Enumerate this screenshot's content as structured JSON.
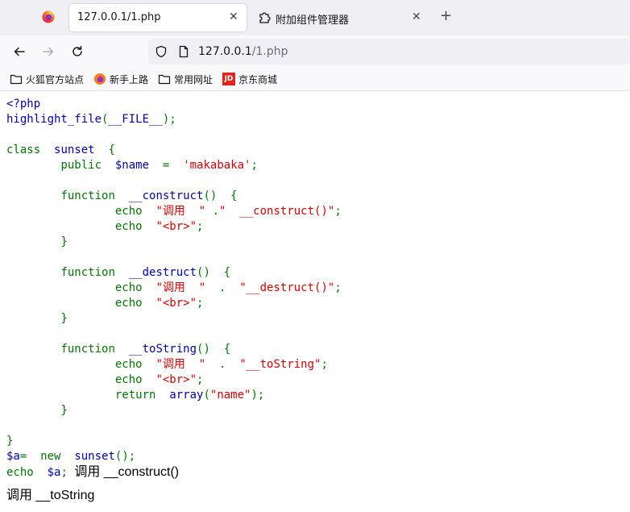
{
  "browser": {
    "tabs": [
      {
        "title": "127.0.0.1/1.php",
        "active": true
      },
      {
        "title": "附加组件管理器",
        "active": false
      }
    ],
    "new_tab_glyph": "+",
    "close_glyph": "✕",
    "url_host": "127.0.0.1",
    "url_path": "/1.php",
    "bookmarks": [
      "火狐官方站点",
      "新手上路",
      "常用网址",
      "京东商城"
    ],
    "jd_icon_text": "JD"
  },
  "colors": {
    "keyword": "#007700",
    "default": "#0000bb",
    "string": "#dd0000"
  },
  "code": {
    "l1": "<?php",
    "l2_fn": "highlight_file",
    "l2_p1": "(",
    "l2_const": "__FILE__",
    "l2_p2": ");",
    "l4_kw": "class",
    "l4_name": "sunset",
    "l4_brace": "{",
    "l5_kw": "public",
    "l5_var": "$name",
    "l5_eq": "=",
    "l5_str": "'makabaka'",
    "l5_semi": ";",
    "fn_kw": "function",
    "construct_name": "__construct",
    "parens_brace": "()  {",
    "destruct_name": "__destruct",
    "tostring_name": "__toString",
    "echo_kw": "echo",
    "str_call_sp": "\"调用  \"",
    "dot": ".",
    "str_construct": "\"  __construct()\"",
    "str_destruct": "\"__destruct()\"",
    "str_tostring": "\"__toString\"",
    "semi": ";",
    "str_br": "\"<br>\"",
    "close_brace": "}",
    "return_kw": "return",
    "array_fn": "array",
    "array_open": "(",
    "array_str": "\"name\"",
    "array_close": ");",
    "final_brace": "}",
    "a_var": "$a",
    "a_eq": "=",
    "new_kw": "new",
    "new_class": "sunset",
    "new_end": "();",
    "echo_var": "$a",
    "echo_semi": ";"
  },
  "output": {
    "line1": "调用 __construct()",
    "line2": "调用 __toString"
  }
}
